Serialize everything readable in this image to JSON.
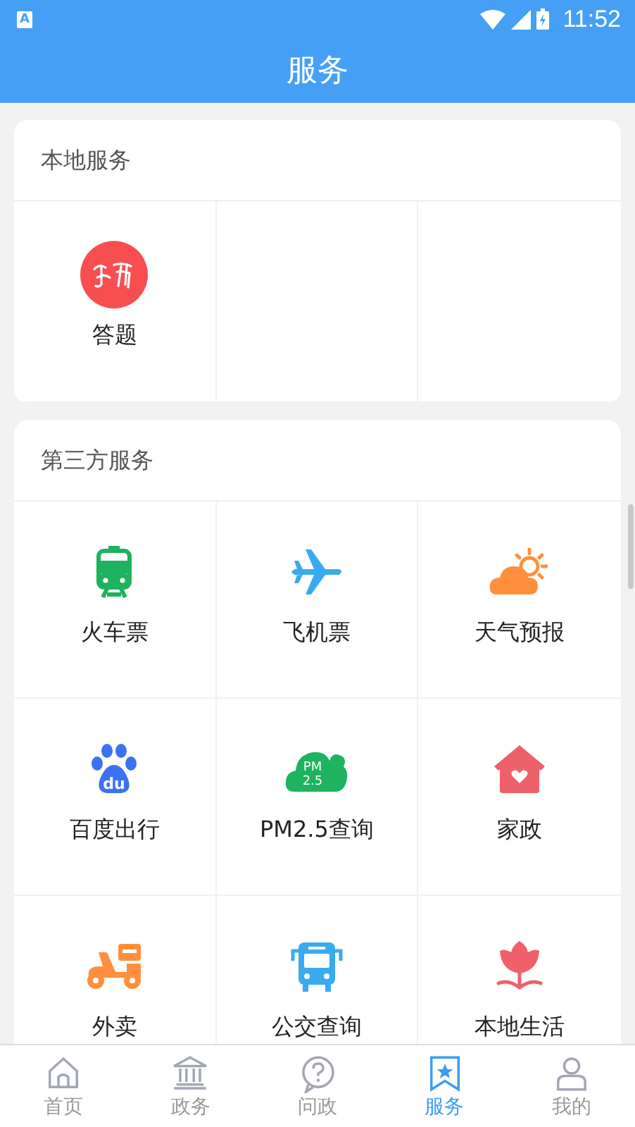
{
  "status_bar": {
    "notification_icon_text": "A",
    "time": "11:52"
  },
  "header": {
    "title": "服务"
  },
  "sections": [
    {
      "title": "本地服务",
      "items": [
        {
          "label": "答题"
        }
      ]
    },
    {
      "title": "第三方服务",
      "items": [
        {
          "label": "火车票"
        },
        {
          "label": "飞机票"
        },
        {
          "label": "天气预报"
        },
        {
          "label": "百度出行",
          "icon_text": [
            "du"
          ]
        },
        {
          "label": "PM2.5查询",
          "icon_text": [
            "PM",
            "2.5"
          ]
        },
        {
          "label": "家政"
        },
        {
          "label": "外卖"
        },
        {
          "label": "公交查询"
        },
        {
          "label": "本地生活"
        }
      ]
    }
  ],
  "bottom_nav": [
    {
      "label": "首页",
      "selected": false
    },
    {
      "label": "政务",
      "selected": false
    },
    {
      "label": "问政",
      "selected": false
    },
    {
      "label": "服务",
      "selected": true
    },
    {
      "label": "我的",
      "selected": false
    }
  ]
}
